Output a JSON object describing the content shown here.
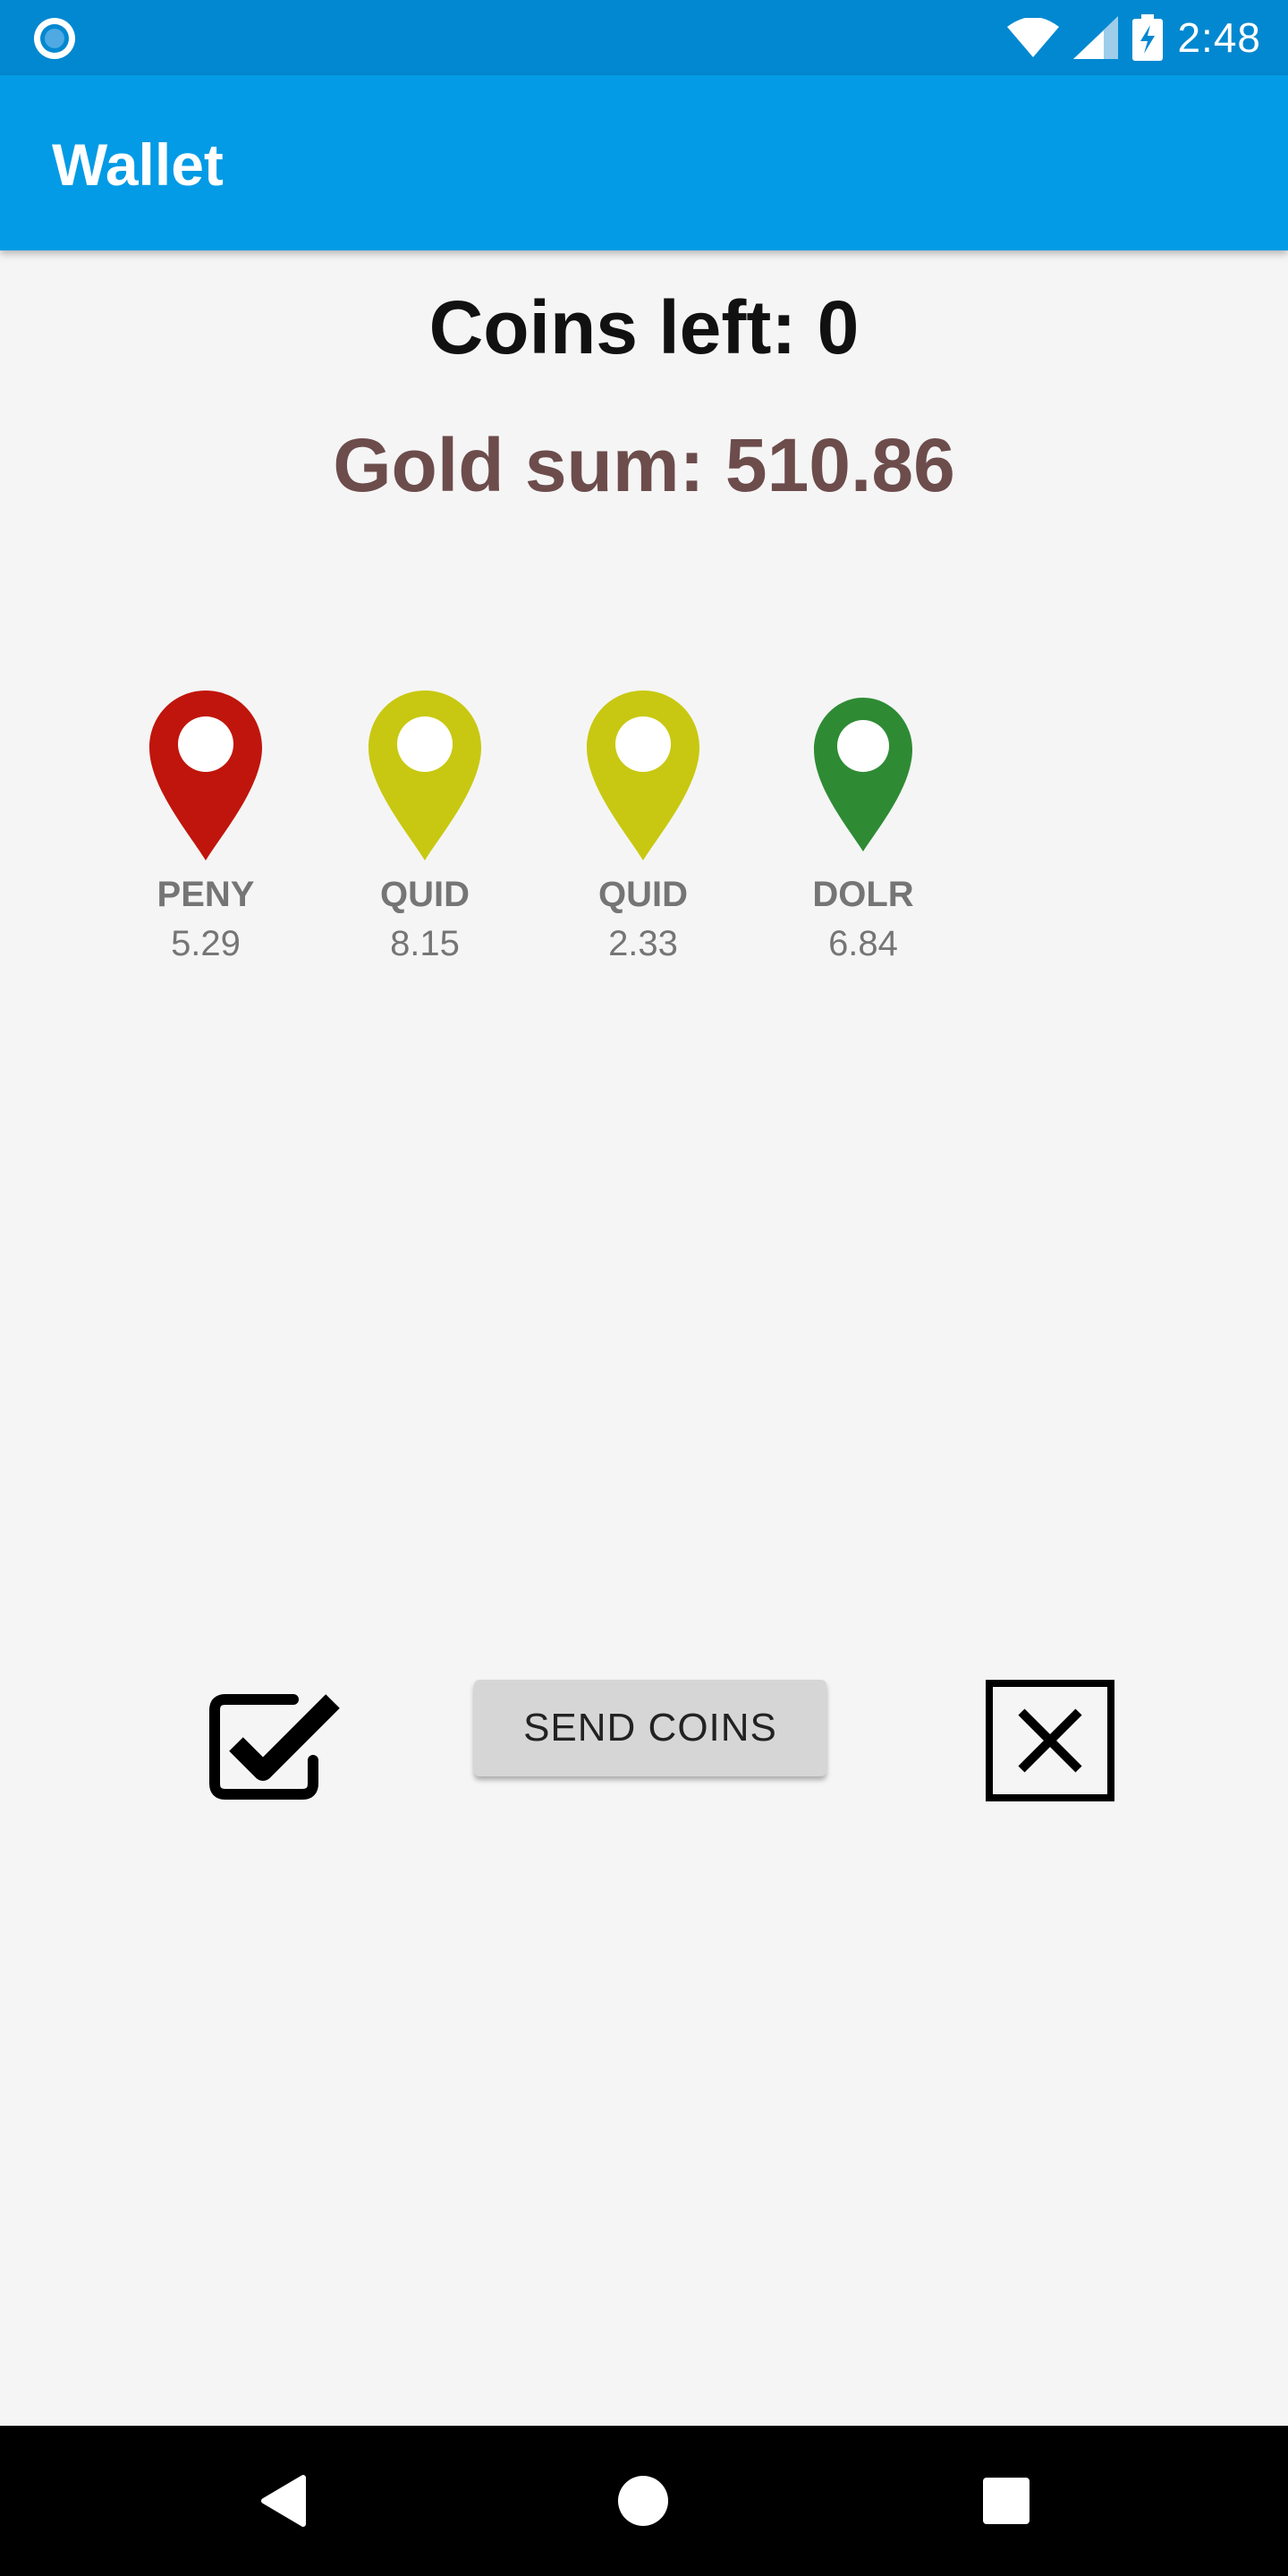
{
  "status_bar": {
    "time": "2:48",
    "icons": [
      "notification-icon",
      "wifi-icon",
      "cell-signal-icon",
      "battery-charging-icon"
    ]
  },
  "app_bar": {
    "title": "Wallet"
  },
  "summary": {
    "coins_left": "Coins left: 0",
    "gold_sum": "Gold sum: 510.86"
  },
  "coins": [
    {
      "currency": "PENY",
      "value": "5.29",
      "color": "#c0150c"
    },
    {
      "currency": "QUID",
      "value": "8.15",
      "color": "#c8c812"
    },
    {
      "currency": "QUID",
      "value": "2.33",
      "color": "#c8c812"
    },
    {
      "currency": "DOLR",
      "value": "6.84",
      "color": "#2e8b34"
    }
  ],
  "actions": {
    "send_label": "SEND COINS",
    "confirm_icon": "checkbox-checked-icon",
    "cancel_icon": "close-box-icon"
  },
  "nav_bar": {
    "icons": [
      "back-icon",
      "home-icon",
      "recents-icon"
    ]
  },
  "colors": {
    "primary_dark": "#0288d1",
    "primary": "#039be5",
    "gold_text": "#6d4c4c"
  }
}
